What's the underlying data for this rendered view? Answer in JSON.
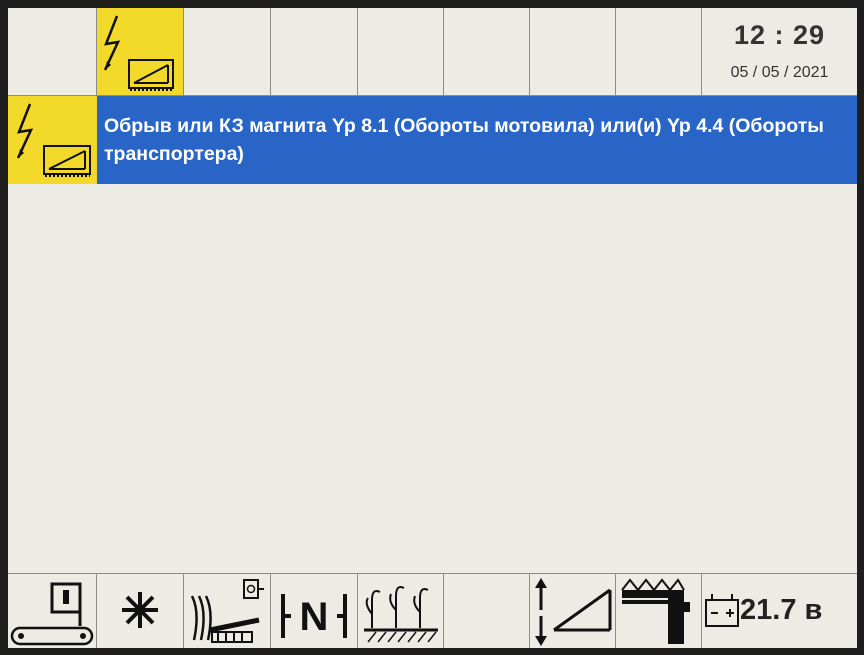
{
  "status": {
    "time": "12 : 29",
    "date": "05 / 05 / 2021"
  },
  "alarm": {
    "message": "Обрыв или КЗ магнита Yp 8.1 (Обороты мотовила) или(и) Yp 4.4 (Обороты транспортера)"
  },
  "bottom": {
    "battery_voltage": "21.7 в"
  },
  "colors": {
    "alarm_bg": "#2965c6",
    "warning_yellow": "#f3da2a",
    "screen_bg": "#ecebe4"
  },
  "icons": {
    "top": [
      "blank",
      "electrical-fault-magnet-icon",
      "blank",
      "blank",
      "blank",
      "blank",
      "blank",
      "blank"
    ],
    "bottom": [
      "conveyor-icon",
      "reel-icon",
      "threshing-drum-icon",
      "neutral-gear-icon",
      "crop-field-icon",
      "blank",
      "header-lift-icon",
      "header-position-icon",
      "battery-icon"
    ]
  }
}
